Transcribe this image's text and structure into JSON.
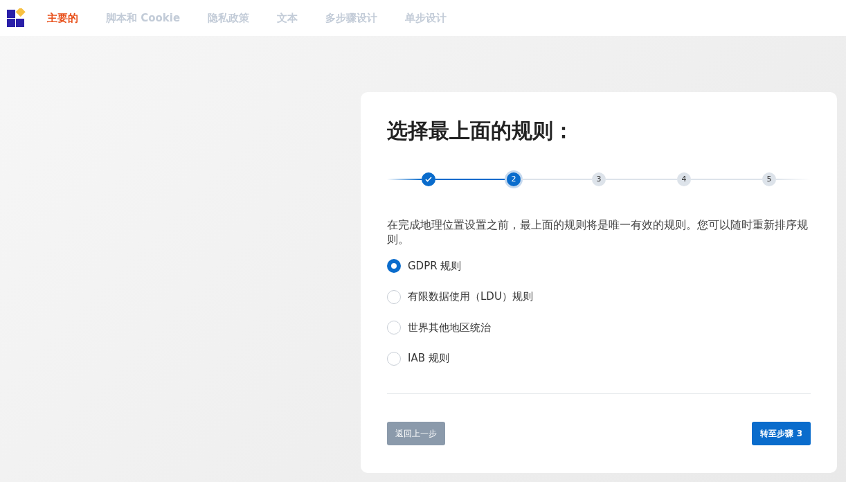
{
  "nav": {
    "items": [
      {
        "label": "主要的",
        "selected": true
      },
      {
        "label": "脚本和 Cookie",
        "selected": false
      },
      {
        "label": "隐私政策",
        "selected": false
      },
      {
        "label": "文本",
        "selected": false
      },
      {
        "label": "多步骤设计",
        "selected": false
      },
      {
        "label": "单步设计",
        "selected": false
      }
    ]
  },
  "card": {
    "title": "选择最上面的规则：",
    "steps": [
      {
        "kind": "done"
      },
      {
        "label": "2",
        "kind": "current"
      },
      {
        "label": "3",
        "kind": "upcoming"
      },
      {
        "label": "4",
        "kind": "upcoming"
      },
      {
        "label": "5",
        "kind": "upcoming"
      }
    ],
    "description": "在完成地理位置设置之前，最上面的规则将是唯一有效的规则。您可以随时重新排序规则。",
    "options": [
      {
        "label": "GDPR 规则",
        "selected": true
      },
      {
        "label": "有限数据使用（LDU）规则",
        "selected": false
      },
      {
        "label": "世界其他地区统治",
        "selected": false
      },
      {
        "label": "IAB 规则",
        "selected": false
      }
    ],
    "back_button": "返回上一步",
    "next_button": "转至步骤 3"
  }
}
